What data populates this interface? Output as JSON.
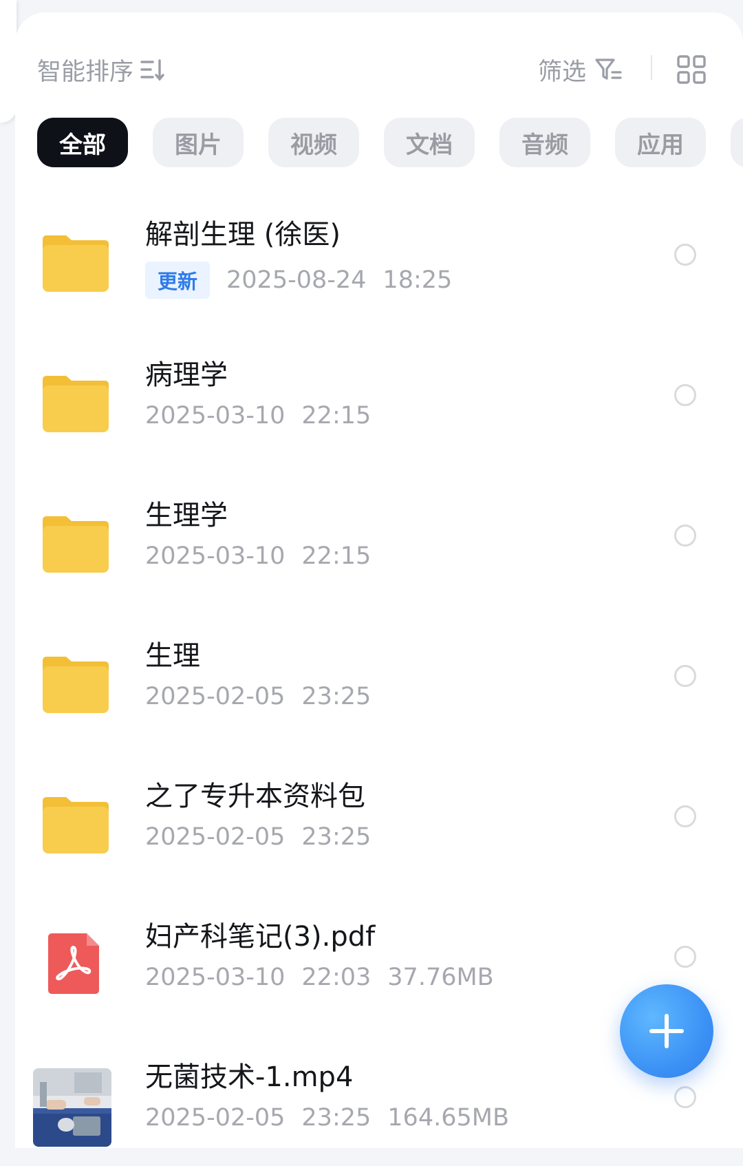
{
  "toolbar": {
    "sort_label": "智能排序",
    "filter_label": "筛选"
  },
  "categories": [
    "全部",
    "图片",
    "视频",
    "文档",
    "音频",
    "应用"
  ],
  "files": [
    {
      "name": "解剖生理 (徐医)",
      "badge": "更新",
      "date": "2025-08-24",
      "time": "18:25",
      "size": "",
      "icon": "folder-icon"
    },
    {
      "name": "病理学",
      "badge": "",
      "date": "2025-03-10",
      "time": "22:15",
      "size": "",
      "icon": "folder-icon"
    },
    {
      "name": "生理学",
      "badge": "",
      "date": "2025-03-10",
      "time": "22:15",
      "size": "",
      "icon": "folder-icon"
    },
    {
      "name": "生理",
      "badge": "",
      "date": "2025-02-05",
      "time": "23:25",
      "size": "",
      "icon": "folder-icon"
    },
    {
      "name": "之了专升本资料包",
      "badge": "",
      "date": "2025-02-05",
      "time": "23:25",
      "size": "",
      "icon": "folder-icon"
    },
    {
      "name": "妇产科笔记(3).pdf",
      "badge": "",
      "date": "2025-03-10",
      "time": "22:03",
      "size": "37.76MB",
      "icon": "pdf-icon"
    },
    {
      "name": "无菌技术-1.mp4",
      "badge": "",
      "date": "2025-02-05",
      "time": "23:25",
      "size": "164.65MB",
      "icon": "video-thumbnail"
    }
  ],
  "colors": {
    "accent": "#2f7bea",
    "folder": "#f8cd4e",
    "pdf": "#ee5a5a",
    "active_chip": "#0e1218"
  }
}
